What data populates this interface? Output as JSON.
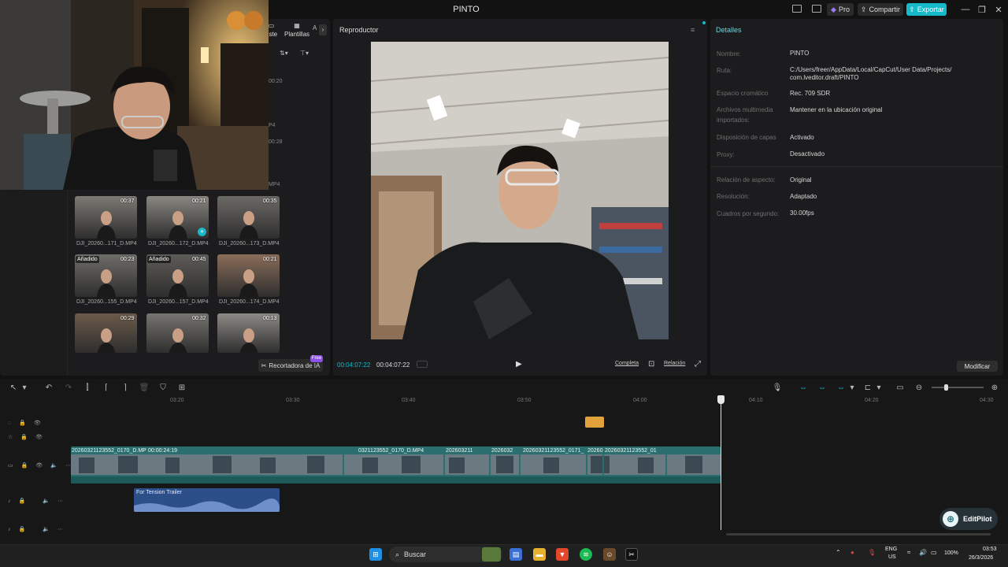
{
  "app": {
    "title": "PINTO",
    "pro_label": "Pro",
    "share_label": "Compartir",
    "export_label": "Exportar"
  },
  "media": {
    "tabs": [
      {
        "label": "Texto",
        "visible_text": "este"
      },
      {
        "label": "Plantillas"
      }
    ],
    "side_durations": [
      "00:20",
      "00:28"
    ],
    "side_exts": [
      "P4",
      "MP4"
    ],
    "thumbs": [
      {
        "duration": "00:37",
        "name": "DJI_20260...171_D.MP4",
        "added": ""
      },
      {
        "duration": "00:21",
        "name": "DJI_20260...172_D.MP4",
        "added": ""
      },
      {
        "duration": "00:35",
        "name": "DJI_20260...173_D.MP4",
        "added": ""
      },
      {
        "duration": "00:23",
        "name": "DJI_20260...155_D.MP4",
        "added": "Añadido"
      },
      {
        "duration": "00:45",
        "name": "DJI_20260...157_D.MP4",
        "added": "Añadido"
      },
      {
        "duration": "00:21",
        "name": "DJI_20260...174_D.MP4",
        "added": ""
      },
      {
        "duration": "00:29",
        "name": "",
        "added": ""
      },
      {
        "duration": "00:32",
        "name": "",
        "added": ""
      },
      {
        "duration": "00:13",
        "name": "",
        "added": ""
      }
    ],
    "ai_cutter_label": "Recortadora de IA",
    "free_tag": "Free"
  },
  "player": {
    "title": "Reproductor",
    "current_time": "00:04:07:22",
    "total_time": "00:04:07:22",
    "full_label": "Completa",
    "ratio_label": "Relación"
  },
  "details": {
    "title": "Detalles",
    "rows": [
      {
        "label": "Nombre:",
        "value": "PINTO"
      },
      {
        "label": "Ruta:",
        "value": "C:/Users/freer/AppData/Local/CapCut/User Data/Projects/ com.lveditor.draft/PINTO"
      },
      {
        "label": "Espacio cromático",
        "value": "Rec. 709 SDR"
      },
      {
        "label": "Archivos multimedia importados:",
        "value": "Mantener en la ubicación original"
      },
      {
        "label": "Disposición de capas",
        "value": "Activado"
      },
      {
        "label": "Proxy:",
        "value": "Desactivado"
      },
      {
        "label": "Relación de aspecto:",
        "value": "Original"
      },
      {
        "label": "Resolución:",
        "value": "Adaptado"
      },
      {
        "label": "Cuadros por segundo:",
        "value": "30.00fps"
      }
    ],
    "modify_label": "Modificar"
  },
  "timeline": {
    "ruler": [
      "03:20",
      "03:30",
      "03:40",
      "03:50",
      "04:00",
      "04:10",
      "04:20",
      "04:30"
    ],
    "main_clip": {
      "name": "20260321123552_0170_D.MP4",
      "duration": "00:00:24:19"
    },
    "clips": [
      "0321123552_0170_D.MP4",
      "202603211",
      "2026032",
      "20260321123552_0171_",
      "2026032",
      "20260321123552_01"
    ],
    "audio_clip": "For Tension Trailer",
    "editpilot_label": "EditPilot"
  },
  "taskbar": {
    "search_placeholder": "Buscar",
    "lang": "ENG",
    "region": "US",
    "battery": "100%",
    "time": "03:53",
    "date": "26/3/2026"
  },
  "colors": {
    "accent": "#16b9c7",
    "video_track": "#2a6e6f",
    "audio_track": "#2c4f8a",
    "details_title": "#6fd4e0"
  }
}
